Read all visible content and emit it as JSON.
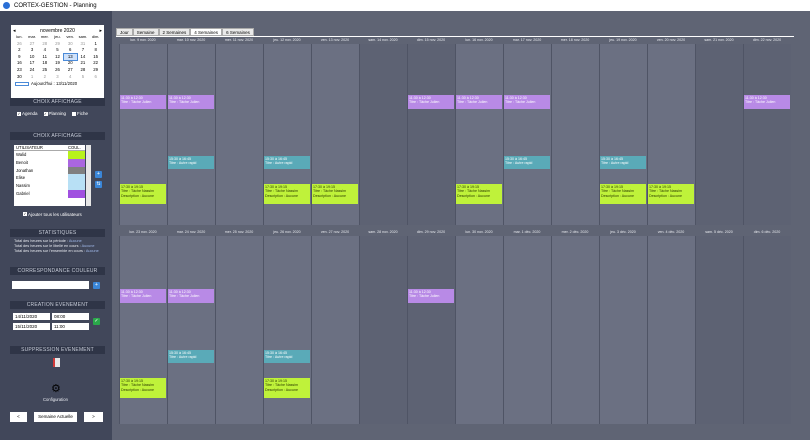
{
  "window": {
    "title": "CORTEX-GESTION - Planning"
  },
  "calendar": {
    "month_label": "novembre 2020",
    "prev": "◂",
    "next": "▸",
    "weekdays": [
      "lun.",
      "mar.",
      "mer.",
      "jeu.",
      "ven.",
      "sam.",
      "dim."
    ],
    "days": [
      [
        "26",
        "27",
        "28",
        "29",
        "30",
        "31",
        "1"
      ],
      [
        "2",
        "3",
        "4",
        "5",
        "6",
        "7",
        "8"
      ],
      [
        "9",
        "10",
        "11",
        "12",
        "13",
        "14",
        "15"
      ],
      [
        "16",
        "17",
        "18",
        "19",
        "20",
        "21",
        "22"
      ],
      [
        "23",
        "24",
        "25",
        "26",
        "27",
        "28",
        "29"
      ],
      [
        "30",
        "1",
        "2",
        "3",
        "4",
        "5",
        "6"
      ]
    ],
    "selected": "13",
    "today_label": "Aujourd'hui : 13/11/2020"
  },
  "display_choice": {
    "title": "CHOIX AFFICHAGE",
    "options": [
      "Agenda",
      "Planning",
      "Fiche"
    ]
  },
  "display_choice2": {
    "title": "CHOIX AFFICHAGE",
    "col_user": "UTILISATEUR",
    "col_color": "COUL.",
    "users": [
      {
        "name": "Walid",
        "color": "#b8f21c"
      },
      {
        "name": "Benoit",
        "color": "#aa66e0"
      },
      {
        "name": "Jonathan",
        "color": "#808080"
      },
      {
        "name": "Elise",
        "color": "#b8e0f5"
      },
      {
        "name": "Nassim",
        "color": "#b8e0f5"
      },
      {
        "name": "Gabriel",
        "color": "#a050e0"
      }
    ],
    "show_all_label": "Ajouter tous les utilisateurs"
  },
  "stats": {
    "title": "STATISTIQUES",
    "lines": [
      {
        "label": "Total des heures sur la période :",
        "value": "Aucune"
      },
      {
        "label": "Total des heures sur le libellé en cours :",
        "value": "Aucune"
      },
      {
        "label": "Total des heures sur l'ensemble en cours :",
        "value": "Aucune"
      }
    ]
  },
  "color_match": {
    "title": "CORRESPONDANCE COULEUR"
  },
  "create_event": {
    "title": "CREATION EVENEMENT",
    "date_start": "14/11/2020",
    "time_start": "08:00",
    "date_end": "15/11/2020",
    "time_end": "11:00"
  },
  "delete_event": {
    "title": "SUPPRESSION EVENEMENT"
  },
  "config_label": "Configuration",
  "nav": {
    "prev": "<",
    "current": "Semaine Actuelle",
    "next": ">"
  },
  "tabs": [
    "Jour",
    "Semaine",
    "2 Semaines",
    "4 Semaines",
    "6 Semaines"
  ],
  "week1": [
    "lun. 9 nov. 2020",
    "mar. 10 nov. 2020",
    "mer. 11 nov. 2020",
    "jeu. 12 nov. 2020",
    "ven. 13 nov. 2020",
    "sam. 14 nov. 2020",
    "dim. 15 nov. 2020",
    "lun. 16 nov. 2020",
    "mar. 17 nov. 2020",
    "mer. 18 nov. 2020",
    "jeu. 19 nov. 2020",
    "ven. 20 nov. 2020",
    "sam. 21 nov. 2020",
    "dim. 22 nov. 2020"
  ],
  "week2": [
    "lun. 23 nov. 2020",
    "mar. 24 nov. 2020",
    "mer. 25 nov. 2020",
    "jeu. 26 nov. 2020",
    "ven. 27 nov. 2020",
    "sam. 28 nov. 2020",
    "dim. 29 nov. 2020",
    "lun. 30 nov. 2020",
    "mar. 1 déc. 2020",
    "mer. 2 déc. 2020",
    "jeu. 3 déc. 2020",
    "ven. 4 déc. 2020",
    "sam. 5 déc. 2020",
    "dim. 6 déc. 2020"
  ],
  "events": {
    "purple": {
      "time": "11:30 à 12:30",
      "line": "Titre : Tâche Julien"
    },
    "teal": {
      "time": "15:30 à 16:45",
      "line": "Titre : Autre rapid"
    },
    "lime": {
      "time": "17:30 à 19:15",
      "line1": "Titre : Tâche Nassim",
      "line2": "Description : Aucune"
    }
  }
}
